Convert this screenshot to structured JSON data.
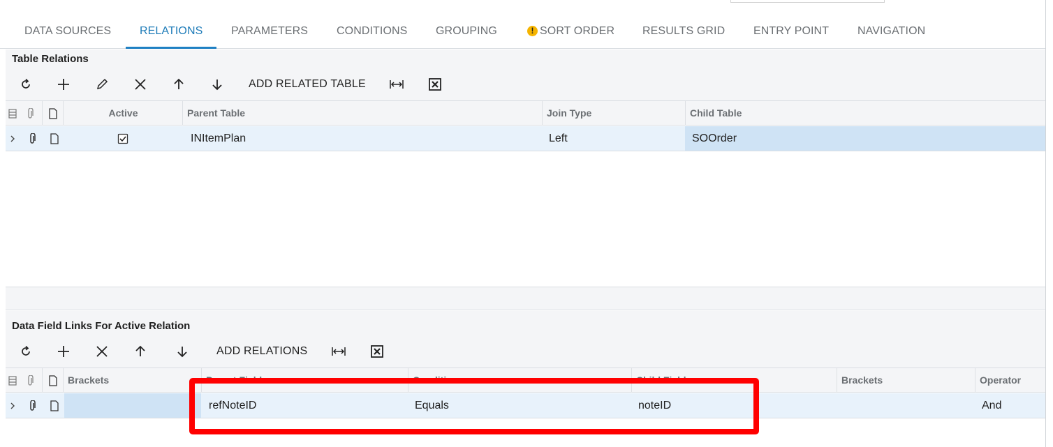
{
  "tabs": [
    {
      "label": "DATA SOURCES"
    },
    {
      "label": "RELATIONS"
    },
    {
      "label": "PARAMETERS"
    },
    {
      "label": "CONDITIONS"
    },
    {
      "label": "GROUPING"
    },
    {
      "label": "SORT ORDER",
      "warning": "!"
    },
    {
      "label": "RESULTS GRID"
    },
    {
      "label": "ENTRY POINT"
    },
    {
      "label": "NAVIGATION"
    }
  ],
  "table_relations": {
    "title": "Table Relations",
    "toolbar": {
      "add_related_table": "ADD RELATED TABLE"
    },
    "columns": {
      "active": "Active",
      "parent_table": "Parent Table",
      "join_type": "Join Type",
      "child_table": "Child Table"
    },
    "rows": [
      {
        "active": true,
        "parent_table": "INItemPlan",
        "join_type": "Left",
        "child_table": "SOOrder"
      }
    ]
  },
  "field_links": {
    "title": "Data Field Links For Active Relation",
    "toolbar": {
      "add_relations": "ADD RELATIONS"
    },
    "columns": {
      "brackets": "Brackets",
      "parent_field": "Parent Field",
      "condition": "Condition",
      "child_field": "Child Field",
      "brackets2": "Brackets",
      "operator": "Operator"
    },
    "rows": [
      {
        "brackets": "",
        "parent_field": "refNoteID",
        "condition": "Equals",
        "child_field": "noteID",
        "brackets2": "",
        "operator": "And"
      }
    ]
  },
  "colors": {
    "accent": "#1f80c3",
    "highlight": "#ff0000",
    "selected_row": "#e8f2fb"
  }
}
